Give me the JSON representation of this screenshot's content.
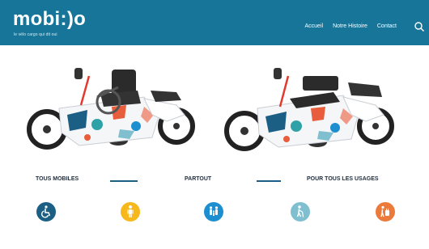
{
  "header": {
    "logo": "mobi:)o",
    "tagline": "le vélo cargo qui dit oui",
    "nav": [
      "Accueil",
      "Notre Histoire",
      "Contact"
    ],
    "icon": "search-icon",
    "color": "#17759a"
  },
  "features": {
    "titles": [
      "TOUS MOBILES",
      "PARTOUT",
      "POUR TOUS LES USAGES"
    ],
    "icons": [
      {
        "name": "wheelchair-icon",
        "color": "#1b5f84"
      },
      {
        "name": "person-icon",
        "color": "#f6b81b"
      },
      {
        "name": "family-icon",
        "color": "#1d8fd0"
      },
      {
        "name": "elderly-walker-icon",
        "color": "#7fbfd0"
      },
      {
        "name": "luggage-icon",
        "color": "#ec7a3b"
      }
    ]
  }
}
